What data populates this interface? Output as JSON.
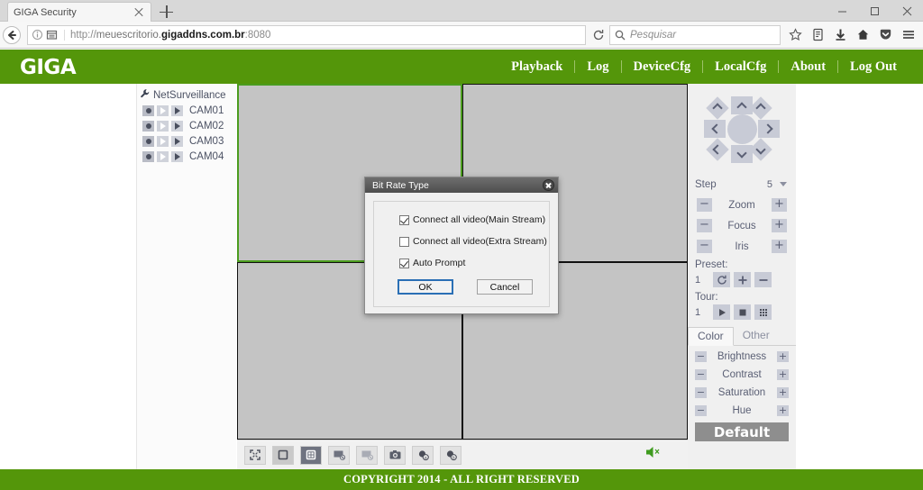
{
  "browser": {
    "tab_title": "GIGA Security",
    "new_tab_label": "+",
    "url_protocol": "http://",
    "url_prefix": "meuescritorio.",
    "url_domain": "gigaddns.com.br",
    "url_port": ":8080",
    "search_placeholder": "Pesquisar",
    "icons": {
      "back": "back-arrow-icon",
      "info": "info-icon",
      "reader": "reader-view-icon",
      "reload": "reload-icon",
      "search": "search-icon",
      "bookmark": "star-icon",
      "library": "library-icon",
      "downloads": "download-icon",
      "home": "home-icon",
      "pocket": "pocket-icon",
      "menu": "hamburger-menu-icon",
      "minimize": "minimize-icon",
      "maximize": "maximize-icon",
      "close": "close-icon"
    }
  },
  "header": {
    "logo": "GIGA",
    "menu": [
      "Playback",
      "Log",
      "DeviceCfg",
      "LocalCfg",
      "About",
      "Log Out"
    ]
  },
  "tree": {
    "root_label": "NetSurveillance",
    "cameras": [
      "CAM01",
      "CAM02",
      "CAM03",
      "CAM04"
    ]
  },
  "video": {
    "panes": 4,
    "selected_pane": 0,
    "toolbar_buttons": [
      "fullscreen-icon",
      "single-view-icon",
      "multi-view-icon",
      "stop-all-record-icon",
      "start-all-record-icon",
      "snapshot-icon",
      "audio-talk-icon",
      "audio-listen-icon"
    ],
    "speaker_icon": "speaker-muted-icon"
  },
  "ptz": {
    "directions": [
      "up-left",
      "up",
      "up-right",
      "left",
      "center",
      "right",
      "down-left",
      "down",
      "down-right"
    ],
    "step_label": "Step",
    "step_value": "5",
    "controls": [
      {
        "label": "Zoom",
        "minus": "−",
        "plus": "+"
      },
      {
        "label": "Focus",
        "minus": "−",
        "plus": "+"
      },
      {
        "label": "Iris",
        "minus": "−",
        "plus": "+"
      }
    ],
    "preset_label": "Preset:",
    "preset_value": "1",
    "preset_buttons": [
      "refresh-icon",
      "add-icon",
      "remove-icon"
    ],
    "tour_label": "Tour:",
    "tour_value": "1",
    "tour_buttons": [
      "play-icon",
      "stop-icon",
      "grid-icon"
    ]
  },
  "color_panel": {
    "tabs": [
      "Color",
      "Other"
    ],
    "active_tab": "Color",
    "sliders": [
      "Brightness",
      "Contrast",
      "Saturation",
      "Hue"
    ],
    "default_label": "Default"
  },
  "dialog": {
    "title": "Bit Rate Type",
    "options": [
      {
        "label": "Connect all video(Main Stream)",
        "checked": true
      },
      {
        "label": "Connect all video(Extra Stream)",
        "checked": false
      },
      {
        "label": "Auto Prompt",
        "checked": true
      }
    ],
    "ok_label": "OK",
    "cancel_label": "Cancel"
  },
  "footer": {
    "text": "COPYRIGHT 2014 - ALL RIGHT RESERVED"
  },
  "colors": {
    "brand_green": "#54960a",
    "selected_pane_border": "#4b9c1e",
    "video_bg": "#c4c4c4",
    "panel_bg": "#f0f0f0",
    "control_gray": "#c8cbd6",
    "control_text": "#5b6075"
  }
}
